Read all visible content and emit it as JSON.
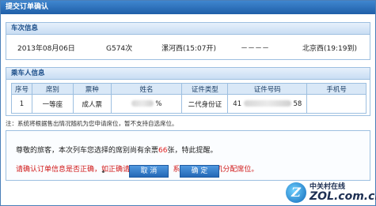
{
  "window": {
    "title": "提交订单确认"
  },
  "train_section": {
    "header": "车次信息",
    "date": "2013年08月06日",
    "train_no": "G574次",
    "depart": "漯河西(15:07开)",
    "separator": "－－－－",
    "arrive": "北京西(19:19到)"
  },
  "passenger_section": {
    "header": "乘车人信息",
    "columns": [
      "序号",
      "席别",
      "票种",
      "姓名",
      "证件类型",
      "证件号码",
      "手机号"
    ],
    "rows": [
      {
        "index": "1",
        "seat": "一等座",
        "ticket_type": "成人票",
        "name_fragment": "%",
        "id_type": "二代身份证",
        "id_prefix": "41",
        "id_suffix": "58",
        "phone": ""
      }
    ]
  },
  "note": "注：系统将根据售出情况随机为您申请席位，暂不支持自选席位。",
  "message": {
    "line1_before": "尊敬的旅客，本次列车您选择的席别尚有余票",
    "line1_count": "66",
    "line1_after": "张，特此提醒。",
    "line2": "请确认订单信息是否正确，如正确请点击“确定”，系统将为您随机分配席位。"
  },
  "buttons": {
    "cancel": "取 消",
    "confirm": "确 定"
  },
  "watermark": {
    "cn": "中关村在线",
    "en": "ZOL.com.cn",
    "logo_letter": "Z"
  },
  "colors": {
    "title_bar": "#1f5fa8",
    "section_border": "#9dbfe0",
    "warning_red": "#d01818",
    "button_blue": "#2468b6"
  }
}
